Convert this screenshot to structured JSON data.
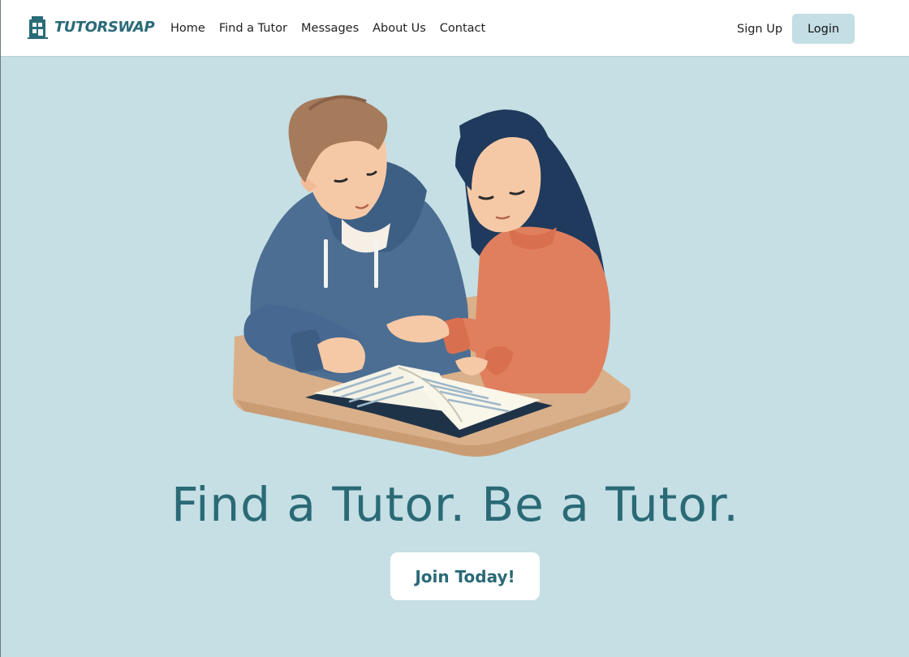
{
  "brand": {
    "name": "TUTORSWAP",
    "color": "#2a6b78"
  },
  "nav": {
    "items": [
      {
        "label": "Home"
      },
      {
        "label": "Find a Tutor"
      },
      {
        "label": "Messages"
      },
      {
        "label": "About Us"
      },
      {
        "label": "Contact"
      }
    ],
    "signup_label": "Sign Up",
    "login_label": "Login"
  },
  "hero": {
    "illustration": "two-students-studying-book-illustration",
    "headline": "Find a Tutor. Be a Tutor.",
    "cta_label": "Join Today!"
  },
  "colors": {
    "background": "#c5dfe4",
    "accent": "#2a6a76",
    "login_button": "#c3dee4"
  }
}
